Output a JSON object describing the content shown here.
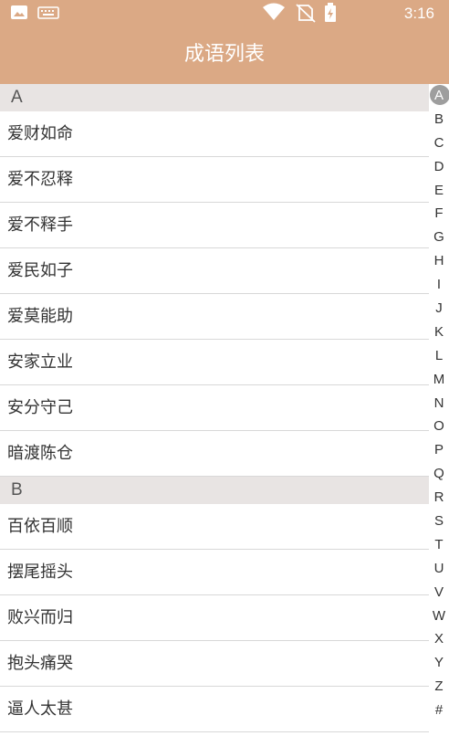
{
  "colors": {
    "accent": "#dba985",
    "section_bg": "#e8e4e3",
    "index_active": "#9e9e9e"
  },
  "status_bar": {
    "time": "3:16",
    "icons": [
      "image-icon",
      "keyboard-icon",
      "wifi-icon",
      "no-sim-icon",
      "battery-charging-icon"
    ]
  },
  "app_bar": {
    "title": "成语列表"
  },
  "sections": [
    {
      "letter": "A",
      "items": [
        "爱财如命",
        "爱不忍释",
        "爱不释手",
        "爱民如子",
        "爱莫能助",
        "安家立业",
        "安分守己",
        "暗渡陈仓"
      ]
    },
    {
      "letter": "B",
      "items": [
        "百依百顺",
        "摆尾摇头",
        "败兴而归",
        "抱头痛哭",
        "逼人太甚"
      ]
    }
  ],
  "index_bar": {
    "active": "A",
    "letters": [
      "A",
      "B",
      "C",
      "D",
      "E",
      "F",
      "G",
      "H",
      "I",
      "J",
      "K",
      "L",
      "M",
      "N",
      "O",
      "P",
      "Q",
      "R",
      "S",
      "T",
      "U",
      "V",
      "W",
      "X",
      "Y",
      "Z",
      "#"
    ]
  }
}
